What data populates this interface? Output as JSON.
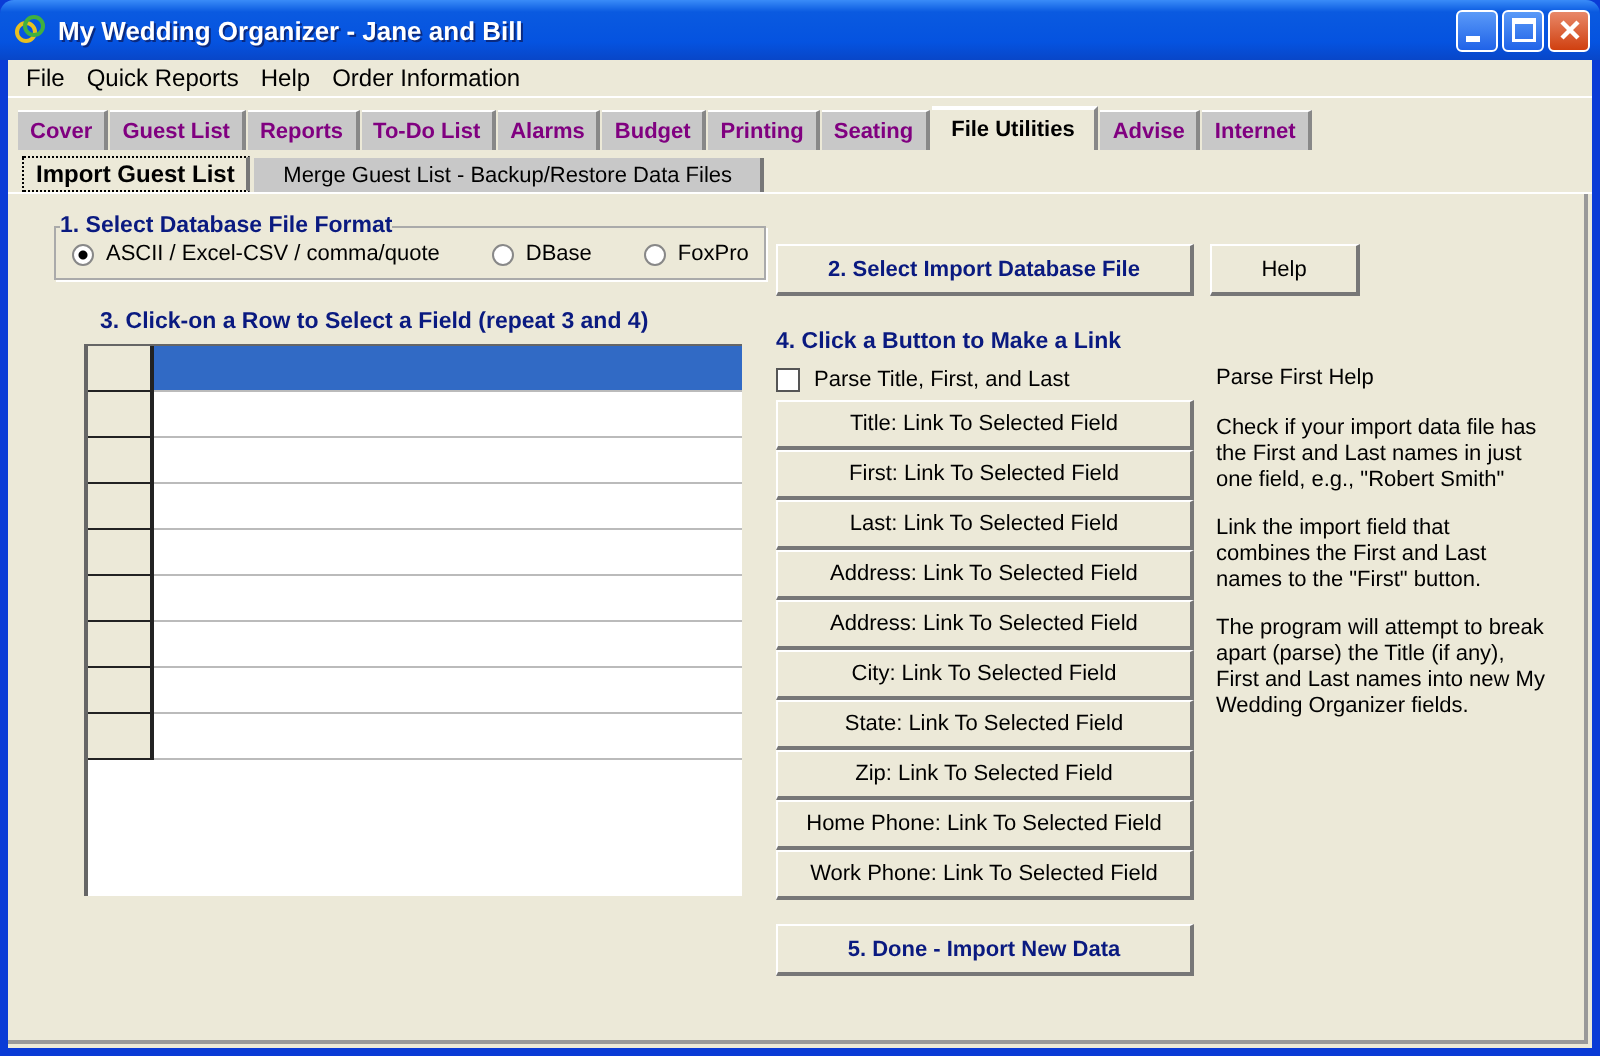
{
  "window": {
    "title": "My Wedding Organizer - Jane and Bill"
  },
  "menu": [
    "File",
    "Quick Reports",
    "Help",
    "Order Information"
  ],
  "tabs": [
    {
      "label": "Cover",
      "selected": false
    },
    {
      "label": "Guest List",
      "selected": false
    },
    {
      "label": "Reports",
      "selected": false
    },
    {
      "label": "To-Do List",
      "selected": false
    },
    {
      "label": "Alarms",
      "selected": false
    },
    {
      "label": "Budget",
      "selected": false
    },
    {
      "label": "Printing",
      "selected": false
    },
    {
      "label": "Seating",
      "selected": false
    },
    {
      "label": "File Utilities",
      "selected": true
    },
    {
      "label": "Advise",
      "selected": false
    },
    {
      "label": "Internet",
      "selected": false
    }
  ],
  "subtabs": [
    {
      "label": "Import Guest List",
      "selected": true
    },
    {
      "label": "Merge Guest List - Backup/Restore Data Files",
      "selected": false
    }
  ],
  "format_group": {
    "title": "1. Select Database File Format",
    "options": [
      {
        "label": "ASCII / Excel-CSV / comma/quote",
        "selected": true
      },
      {
        "label": "DBase",
        "selected": false
      },
      {
        "label": "FoxPro",
        "selected": false
      }
    ]
  },
  "select_button": "2. Select Import Database File",
  "help_button": "Help",
  "grid": {
    "heading": "3. Click-on a Row to Select a Field (repeat 3 and 4)",
    "rows": [
      {
        "selected": true
      },
      {
        "selected": false
      },
      {
        "selected": false
      },
      {
        "selected": false
      },
      {
        "selected": false
      },
      {
        "selected": false
      },
      {
        "selected": false
      },
      {
        "selected": false
      },
      {
        "selected": false
      }
    ]
  },
  "link_section": {
    "heading": "4. Click a Button to Make a Link",
    "parse_checkbox": {
      "label": "Parse Title, First, and Last",
      "checked": false
    },
    "buttons": [
      "Title: Link To Selected Field",
      "First: Link To Selected Field",
      "Last: Link To Selected Field",
      "Address: Link To Selected Field",
      "Address: Link To Selected Field",
      "City: Link To Selected Field",
      "State: Link To Selected Field",
      "Zip: Link To Selected Field",
      "Home Phone: Link To Selected Field",
      "Work Phone: Link To Selected Field"
    ]
  },
  "done_button": "5. Done - Import New Data",
  "parse_help": {
    "title": "Parse First Help",
    "paragraphs": [
      "Check if your import data file has the First and Last names in just one field, e.g., \"Robert Smith\"",
      "Link the import field that combines the First and Last names to the \"First\" button.",
      "The program will attempt to break apart (parse) the Title (if any), First and Last names into new My Wedding Organizer fields."
    ]
  }
}
